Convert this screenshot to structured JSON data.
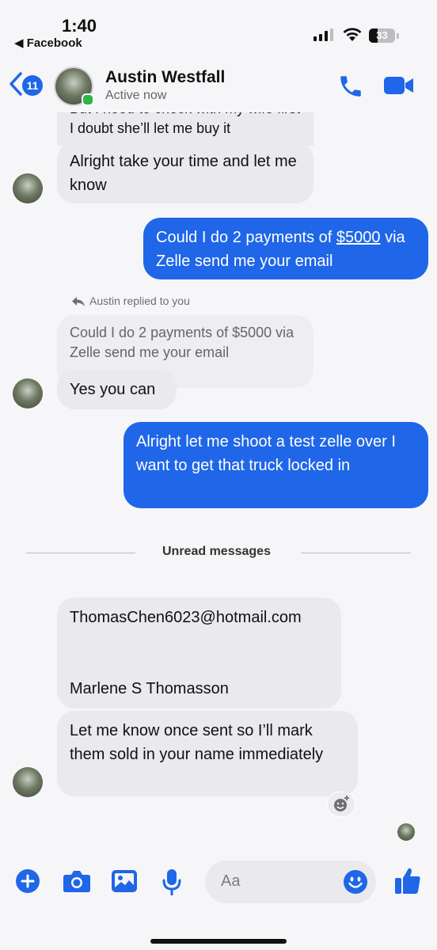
{
  "status_bar": {
    "time": "1:40",
    "back_app": "◀ Facebook",
    "battery": "33"
  },
  "header": {
    "unread_count": "11",
    "contact_name": "Austin Westfall",
    "contact_status": "Active now"
  },
  "messages": {
    "partial_top": "But I need to check with my wife first I doubt she’ll let me buy it",
    "m1": "Alright take your time and let me know",
    "m2_prefix": "Could I do 2 payments of ",
    "m2_link": "$5000",
    "m2_suffix": " via Zelle send me your email",
    "replied_note": "Austin replied to you",
    "quote": "Could I do 2 payments of $5000 via Zelle send me your email",
    "m3": "Yes you can",
    "m4": "Alright let me shoot a test zelle over I want to get that truck locked in",
    "unread_label": "Unread messages",
    "m5_email": "ThomasChen6023@hotmail.com",
    "m5_name": "Marlene S Thomasson",
    "m6": "Let me know once sent so I’ll mark them sold in your name immediately"
  },
  "composer": {
    "placeholder": "Aa"
  },
  "colors": {
    "accent": "#1f66e8",
    "incoming_bubble": "#e9e9ee",
    "online": "#31b24a"
  }
}
